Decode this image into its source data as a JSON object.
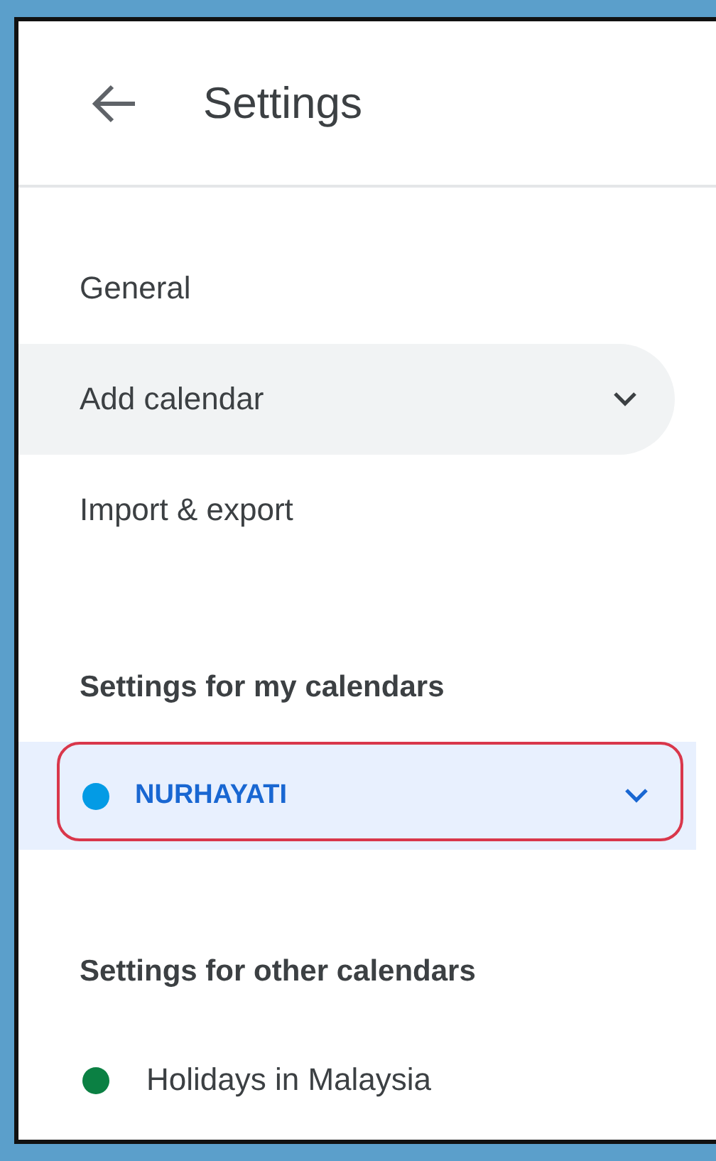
{
  "header": {
    "title": "Settings"
  },
  "nav_items": [
    {
      "label": "General",
      "kind": "link",
      "selected": false
    },
    {
      "label": "Add calendar",
      "kind": "expandable",
      "selected": true,
      "expanded": false
    },
    {
      "label": "Import & export",
      "kind": "link",
      "selected": false
    }
  ],
  "sections": [
    {
      "heading": "Settings for my calendars",
      "calendars": [
        {
          "name": "NURHAYATI",
          "color": "#039be5",
          "kind": "expandable",
          "selected": true,
          "expanded": false,
          "outlined": true
        }
      ]
    },
    {
      "heading": "Settings for other calendars",
      "calendars": [
        {
          "name": "Holidays in Malaysia",
          "color": "#0b8043",
          "kind": "link",
          "selected": false,
          "outlined": false
        }
      ]
    }
  ]
}
